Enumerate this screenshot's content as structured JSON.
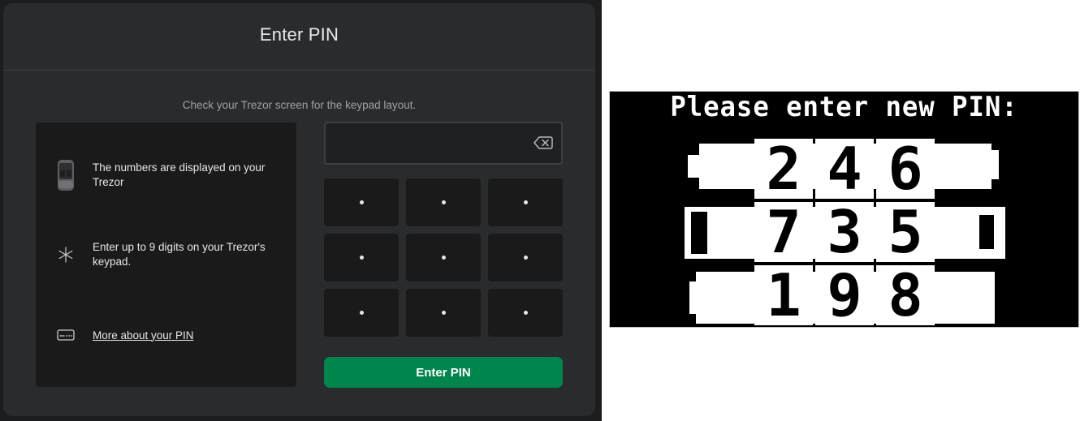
{
  "modal": {
    "title": "Enter PIN",
    "instruction": "Check your Trezor screen for the keypad layout."
  },
  "info": {
    "items": [
      {
        "icon": "trezor-device-icon",
        "text": "The numbers are displayed on your Trezor"
      },
      {
        "icon": "asterisk-icon",
        "text": "Enter up to 9 digits on your Trezor's keypad."
      },
      {
        "icon": "keyboard-icon",
        "text": "More about your PIN",
        "link": true
      }
    ]
  },
  "pin_field": {
    "value": "",
    "backspace_icon": "backspace-icon"
  },
  "keypad": {
    "keys": [
      "•",
      "•",
      "•",
      "•",
      "•",
      "•",
      "•",
      "•",
      "•"
    ]
  },
  "enter_button": {
    "label": "Enter PIN",
    "color": "#00854d"
  },
  "device_screen": {
    "prompt": "Please enter new PIN:",
    "digits": [
      "2",
      "4",
      "6",
      "7",
      "3",
      "5",
      "1",
      "9",
      "8"
    ]
  },
  "colors": {
    "background": "#1c1d1e",
    "modal": "#2a2b2d",
    "panel": "#1a1a1b",
    "accent": "#00854d"
  }
}
